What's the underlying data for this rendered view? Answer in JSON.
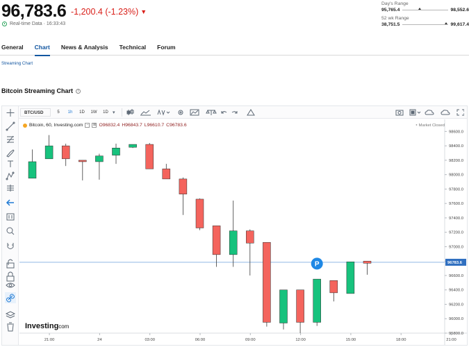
{
  "header": {
    "price": "96,783.6",
    "change": "-1,200.4 (-1.23%)",
    "change_arrow": "▼",
    "realtime": "Real-time Data · 16:33:43"
  },
  "ranges": [
    {
      "label": "Day's Range",
      "low": "95,765.4",
      "high": "98,552.6",
      "position": 0.38
    },
    {
      "label": "52 wk Range",
      "low": "38,751.5",
      "high": "99,617.4",
      "position": 0.96
    }
  ],
  "tabs": [
    "General",
    "Chart",
    "News & Analysis",
    "Technical",
    "Forum"
  ],
  "active_tab": "Chart",
  "sublink": "Streaming Chart",
  "chart_title": "Bitcoin Streaming Chart",
  "toolbar": {
    "symbol": "BTC/USD",
    "timeframes": [
      "5",
      "1h",
      "1D",
      "1W",
      "1D"
    ],
    "active_timeframe": "1h"
  },
  "legend": {
    "name": "Bitcoin, 60, Investing.com",
    "o": "O96832.4",
    "h": "H96843.7",
    "l": "L96610.7",
    "c": "C96783.6"
  },
  "market_status": "Market Closed",
  "brand": "Investing",
  "brand_suffix": ".com",
  "colors": {
    "up": "#17c27d",
    "down": "#f4645d",
    "accent": "#1256a0",
    "price_line": "#4d8dd3"
  },
  "chart_data": {
    "type": "candlestick",
    "ylim": [
      95800,
      98700
    ],
    "y_ticks": [
      95800,
      96000,
      96200,
      96400,
      96600,
      96800,
      97000,
      97200,
      97400,
      97600,
      97800,
      98000,
      98200,
      98400,
      98600
    ],
    "y_tick_labels": [
      "95800.0",
      "96000.0",
      "96200.0",
      "96400.0",
      "96600.0",
      "96800.0",
      "97000.0",
      "97200.0",
      "97400.0",
      "97600.0",
      "97800.0",
      "98000.0",
      "98200.0",
      "98400.0",
      "98600.0"
    ],
    "x_ticks": [
      {
        "label": "21:00",
        "index": 1
      },
      {
        "label": "24",
        "index": 4
      },
      {
        "label": "03:00",
        "index": 7
      },
      {
        "label": "06:00",
        "index": 10
      },
      {
        "label": "09:00",
        "index": 13
      },
      {
        "label": "12:00",
        "index": 16
      },
      {
        "label": "15:00",
        "index": 19
      },
      {
        "label": "18:00",
        "index": 22
      },
      {
        "label": "21:00",
        "index": 25
      }
    ],
    "candles": [
      {
        "o": 97950,
        "h": 98350,
        "l": 97950,
        "c": 98180
      },
      {
        "o": 98220,
        "h": 98550,
        "l": 98220,
        "c": 98400
      },
      {
        "o": 98400,
        "h": 98430,
        "l": 98120,
        "c": 98220
      },
      {
        "o": 98200,
        "h": 98200,
        "l": 97920,
        "c": 98180
      },
      {
        "o": 98180,
        "h": 98290,
        "l": 97930,
        "c": 98260
      },
      {
        "o": 98270,
        "h": 98430,
        "l": 98150,
        "c": 98370
      },
      {
        "o": 98380,
        "h": 98420,
        "l": 98370,
        "c": 98420
      },
      {
        "o": 98420,
        "h": 98440,
        "l": 98080,
        "c": 98080
      },
      {
        "o": 98080,
        "h": 98150,
        "l": 97940,
        "c": 97940
      },
      {
        "o": 97940,
        "h": 97960,
        "l": 97440,
        "c": 97730
      },
      {
        "o": 97660,
        "h": 97670,
        "l": 97230,
        "c": 97260
      },
      {
        "o": 97290,
        "h": 97290,
        "l": 96720,
        "c": 96890
      },
      {
        "o": 96890,
        "h": 97640,
        "l": 96720,
        "c": 97220
      },
      {
        "o": 97220,
        "h": 97240,
        "l": 96600,
        "c": 97050
      },
      {
        "o": 97060,
        "h": 97060,
        "l": 95890,
        "c": 95950
      },
      {
        "o": 95940,
        "h": 96380,
        "l": 95850,
        "c": 96400
      },
      {
        "o": 96400,
        "h": 96400,
        "l": 95800,
        "c": 95950
      },
      {
        "o": 95950,
        "h": 96550,
        "l": 95900,
        "c": 96550
      },
      {
        "o": 96530,
        "h": 96530,
        "l": 96240,
        "c": 96360
      },
      {
        "o": 96350,
        "h": 96790,
        "l": 96350,
        "c": 96790
      },
      {
        "o": 96800,
        "h": 96800,
        "l": 96610,
        "c": 96770
      }
    ],
    "last_price": "96783.6",
    "last_price_value": 96783.6,
    "marker_label": "P",
    "marker_index": 17
  }
}
